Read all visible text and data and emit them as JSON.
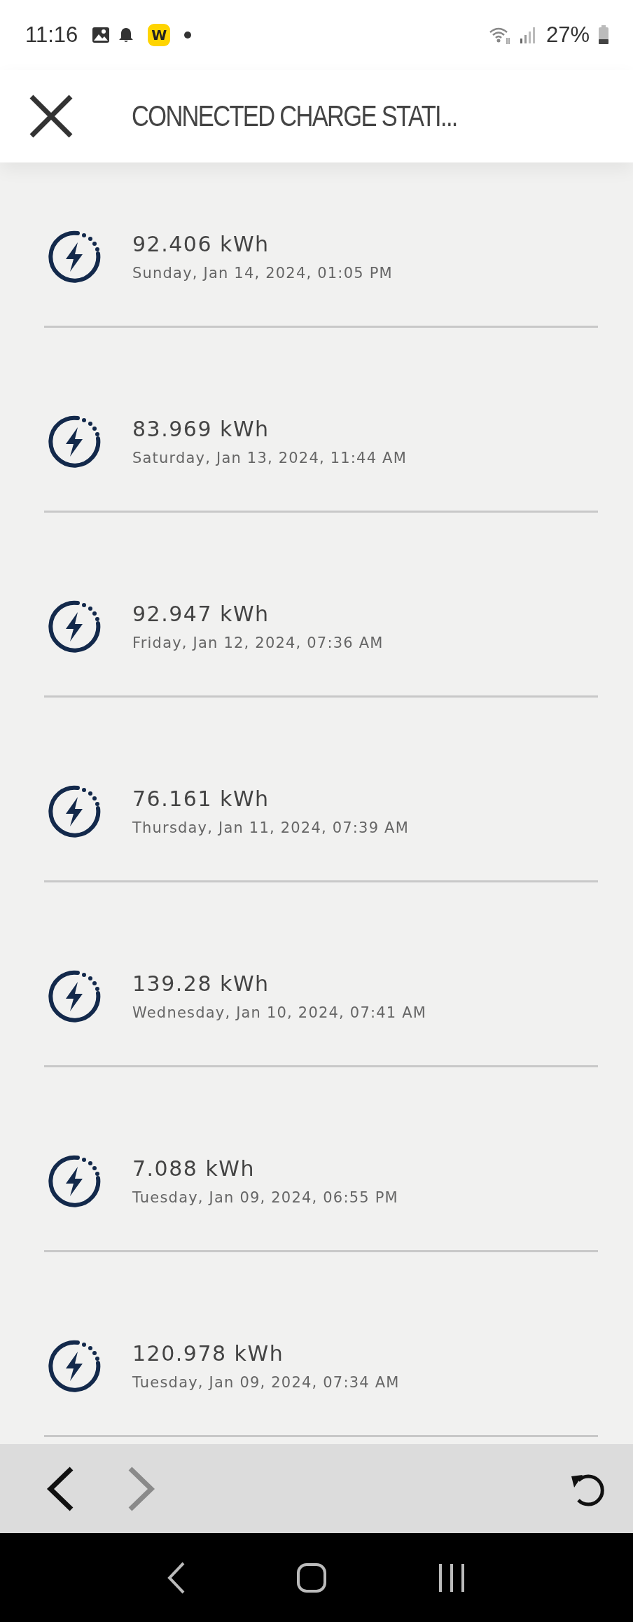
{
  "status_bar": {
    "time": "11:16",
    "app_badge": "W",
    "battery": "27%"
  },
  "header": {
    "title": "CONNECTED CHARGE STATI..."
  },
  "sessions": [
    {
      "energy": "92.406 kWh",
      "date": "Sunday, Jan 14, 2024, 01:05 PM"
    },
    {
      "energy": "83.969 kWh",
      "date": "Saturday, Jan 13, 2024, 11:44 AM"
    },
    {
      "energy": "92.947 kWh",
      "date": "Friday, Jan 12, 2024, 07:36 AM"
    },
    {
      "energy": "76.161 kWh",
      "date": "Thursday, Jan 11, 2024, 07:39 AM"
    },
    {
      "energy": "139.28 kWh",
      "date": "Wednesday, Jan 10, 2024, 07:41 AM"
    },
    {
      "energy": "7.088 kWh",
      "date": "Tuesday, Jan 09, 2024, 06:55 PM"
    },
    {
      "energy": "120.978 kWh",
      "date": "Tuesday, Jan 09, 2024, 07:34 AM"
    }
  ],
  "toolbar": {
    "back": {
      "disabled": false
    },
    "forward": {
      "disabled": true
    }
  }
}
